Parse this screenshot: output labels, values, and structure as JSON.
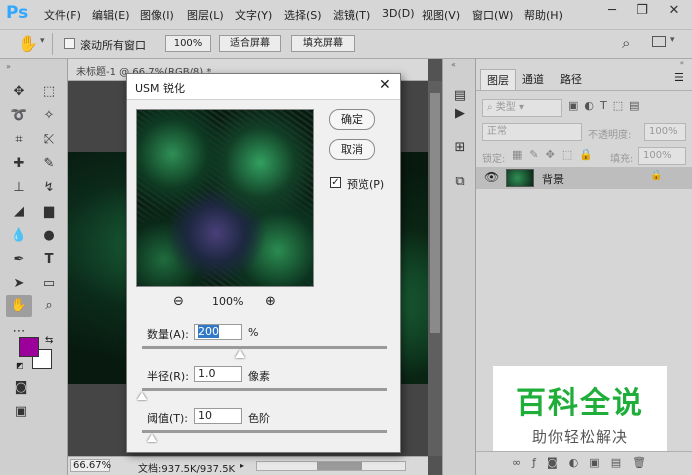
{
  "app": {
    "logo": "Ps"
  },
  "menu": [
    "文件(F)",
    "编辑(E)",
    "图像(I)",
    "图层(L)",
    "文字(Y)",
    "选择(S)",
    "滤镜(T)",
    "3D(D)",
    "视图(V)",
    "窗口(W)",
    "帮助(H)"
  ],
  "options": {
    "scroll_all": "滚动所有窗口",
    "zoom": "100%",
    "fit_screen": "适合屏幕",
    "fill_screen": "填充屏幕"
  },
  "document": {
    "tab": "未标题-1 @ 66.7%(RGB/8) *",
    "zoom": "66.67%",
    "doc_size": "文档:937.5K/937.5K"
  },
  "panel": {
    "tabs": [
      "图层",
      "通道",
      "路径"
    ],
    "filter_type": "类型",
    "blend_mode": "正常",
    "opacity_label": "不透明度:",
    "opacity": "100%",
    "lock_label": "锁定:",
    "fill_label": "填充:",
    "fill": "100%",
    "layer_name": "背景"
  },
  "dialog": {
    "title": "USM 锐化",
    "ok": "确定",
    "cancel": "取消",
    "preview_label": "预览(P)",
    "preview_zoom": "100%",
    "amount_label": "数量(A):",
    "amount": "200",
    "amount_unit": "%",
    "amount_level": 0.4,
    "radius_label": "半径(R):",
    "radius": "1.0",
    "radius_unit": "像素",
    "radius_level": 0.0,
    "threshold_label": "阈值(T):",
    "threshold": "10",
    "threshold_unit": "色阶",
    "threshold_level": 0.04
  },
  "watermark": {
    "title": "百科全说",
    "subtitle": "助你轻松解决"
  },
  "colors": {
    "foreground": "#9b009b",
    "background": "#ffffff",
    "accent": "#31a8ff",
    "watermark_green": "#1fae3a"
  }
}
